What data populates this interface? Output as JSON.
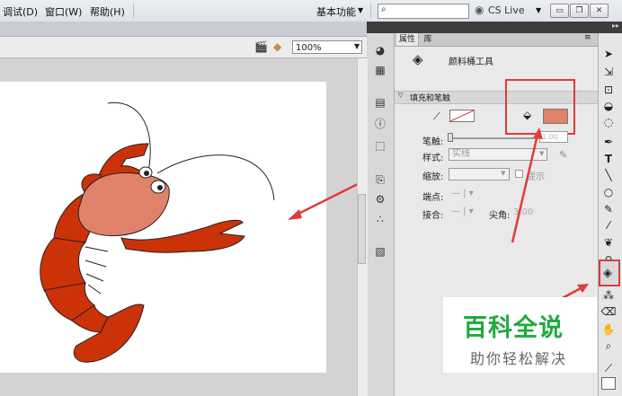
{
  "menu": {
    "items": [
      "调试(D)",
      "窗口(W)",
      "帮助(H)"
    ],
    "workspace_label": "基本功能",
    "search_placeholder": "",
    "cs_live_label": "CS Live"
  },
  "window_buttons": [
    "minimize",
    "restore",
    "close"
  ],
  "edit_bar": {
    "zoom_value": "100%"
  },
  "panel_tabs": [
    "属性",
    "库"
  ],
  "properties": {
    "tool_name": "颜料桶工具",
    "section_title": "填充和笔触",
    "stroke_label": "笔触:",
    "stroke_value": "1.00",
    "style_label": "样式:",
    "style_value": "实线",
    "scale_label": "缩放:",
    "hint_label": "提示",
    "cap_label": "端点:",
    "join_label": "接合:",
    "miter_label": "尖角:",
    "miter_value": "3.00"
  },
  "colors": {
    "fill_swatch": "#e0826a",
    "highlight_red": "#e03a3a",
    "crayfish_body": "#cc3208",
    "crayfish_head": "#e0826a",
    "watermark_green": "#1dab3c"
  },
  "tools": [
    "selection-icon",
    "subselect-icon",
    "free-transform-icon",
    "3d-rotate-icon",
    "lasso-icon",
    "pen-icon",
    "text-icon",
    "line-icon",
    "oval-icon",
    "pencil-icon",
    "brush-icon",
    "deco-icon",
    "bone-icon",
    "paint-bucket-icon",
    "eyedropper-icon",
    "eraser-icon",
    "hand-icon",
    "zoom-icon",
    "stroke-color-icon",
    "fill-color-icon"
  ],
  "watermark": {
    "title": "百科全说",
    "subtitle": "助你轻松解决"
  }
}
